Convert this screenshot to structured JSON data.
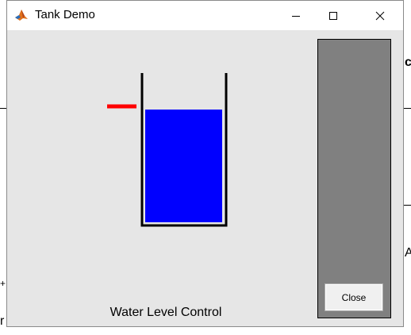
{
  "window": {
    "title": "Tank Demo"
  },
  "tank": {
    "water_level_fraction": 0.82,
    "setpoint_fraction": 0.79,
    "water_color": "#0000ff",
    "setpoint_color": "#ff0000",
    "wall_color": "#000000"
  },
  "panel": {
    "color": "#808080",
    "close_label": "Close"
  },
  "caption": "Water Level Control",
  "background": {
    "fragment_right_bold": "c",
    "fragment_right": "A",
    "fragment_left_plus": "+",
    "fragment_left_r": "r"
  },
  "icons": {
    "app": "matlab-icon",
    "minimize": "minimize-icon",
    "maximize": "maximize-icon",
    "close": "close-icon"
  }
}
